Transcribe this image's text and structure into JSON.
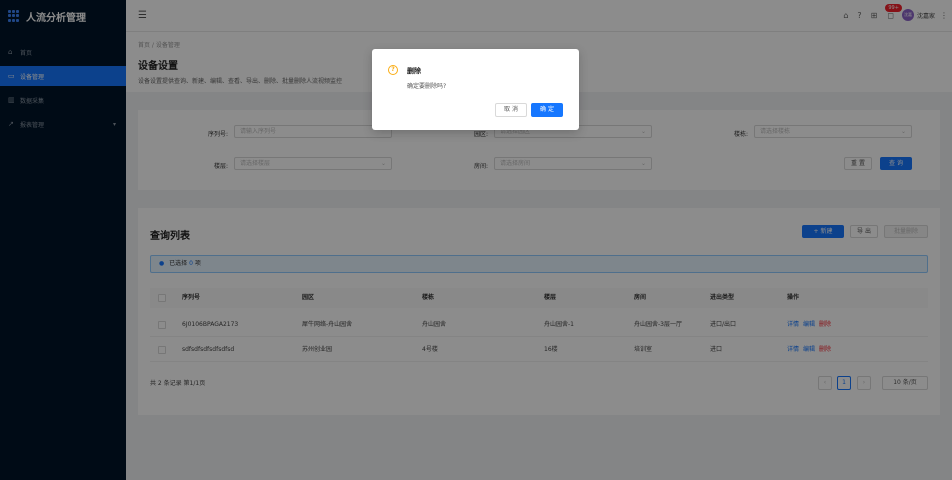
{
  "app": {
    "title": "人流分析管理"
  },
  "sidebar": {
    "items": [
      {
        "label": "首页",
        "icon": "home-icon"
      },
      {
        "label": "设备管理",
        "icon": "device-icon",
        "active": true
      },
      {
        "label": "数据采集",
        "icon": "bar-chart-icon"
      },
      {
        "label": "报表管理",
        "icon": "line-chart-icon",
        "has_children": true
      }
    ]
  },
  "header": {
    "notification_count": "99+",
    "avatar_text": "沈嘉",
    "username": "沈嘉家"
  },
  "page": {
    "breadcrumb": "首页 / 设备管理",
    "title": "设备设置",
    "description": "设备设置提供查询、新建、编辑、查看、导出、删除、批量删除人流视频监控"
  },
  "search": {
    "serial_label": "序列号:",
    "serial_placeholder": "请输入序列号",
    "park_label": "园区:",
    "park_placeholder": "请选择园区",
    "building_label": "楼栋:",
    "building_placeholder": "请选择楼栋",
    "floor_label": "楼层:",
    "floor_placeholder": "请选择楼层",
    "room_label": "房间:",
    "room_placeholder": "请选择房间",
    "reset_label": "重 置",
    "query_label": "查 询"
  },
  "list": {
    "title": "查询列表",
    "new_label": "+ 新建",
    "export_label": "导 出",
    "batch_delete_label": "批量删除",
    "alert_prefix": "已选择",
    "alert_count": "0",
    "alert_suffix": "项",
    "columns": [
      "序列号",
      "园区",
      "楼栋",
      "楼层",
      "房间",
      "进出类型",
      "操作"
    ],
    "rows": [
      {
        "serial": "6J0106BPAGA2173",
        "park": "犀牛网络-舟山园舍",
        "building": "舟山园舍",
        "floor": "舟山园舍-1",
        "room": "舟山园舍-3层一厅",
        "type": "进口/出口"
      },
      {
        "serial": "sdfsdfsdfsdfsdfsd",
        "park": "苏州创业园",
        "building": "4号楼",
        "floor": "16楼",
        "room": "培训室",
        "type": "进口"
      }
    ],
    "actions": {
      "detail": "详情",
      "edit": "编辑",
      "delete": "删除"
    },
    "total_text": "共 2 条记录 第1/1页",
    "current_page": "1",
    "page_size": "10 条/页"
  },
  "modal": {
    "title": "删除",
    "content": "确定要删除吗?",
    "cancel_label": "取 消",
    "ok_label": "确 定"
  },
  "colors": {
    "primary": "#1677ff",
    "danger": "#f5222d",
    "warning": "#faad14",
    "sidebar_bg": "#001529"
  }
}
